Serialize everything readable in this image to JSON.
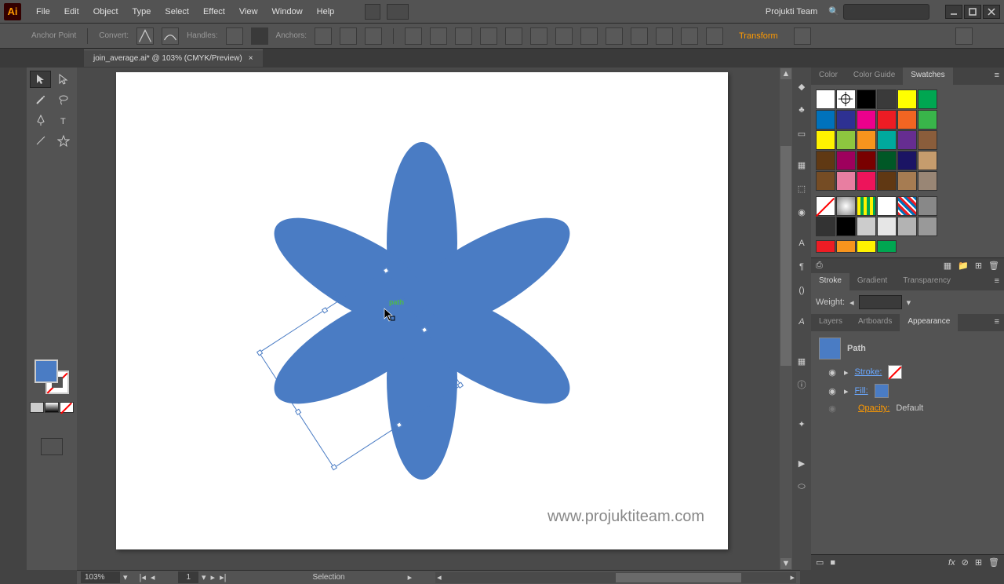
{
  "app": {
    "name": "Ai",
    "team_label": "Projukti Team"
  },
  "menu": [
    "File",
    "Edit",
    "Object",
    "Type",
    "Select",
    "Effect",
    "View",
    "Window",
    "Help"
  ],
  "control_bar": {
    "anchor_label": "Anchor Point",
    "convert_label": "Convert:",
    "handles_label": "Handles:",
    "anchors_label": "Anchors:",
    "transform_label": "Transform"
  },
  "document": {
    "tab_title": "join_average.ai* @ 103% (CMYK/Preview)"
  },
  "cursor_hint": "path",
  "watermark": "www.projuktiteam.com",
  "status": {
    "zoom": "103%",
    "artboard_nav": "1",
    "mode": "Selection"
  },
  "panels": {
    "color_tabs": [
      "Color",
      "Color Guide",
      "Swatches"
    ],
    "color_active": "Swatches",
    "swatches_rows": [
      [
        "#ffffff",
        "registration",
        "#000000",
        "#3a3a3a",
        "#ffff00",
        "#00a651"
      ],
      [
        "#0072bc",
        "#2e3192",
        "#ec008c",
        "#ed1c24",
        "#f26522",
        "#39b54a"
      ],
      [
        "#fff200",
        "#8dc63f",
        "#f7941d",
        "#00a99d",
        "#662d91",
        "#8a5d3b"
      ],
      [
        "#603913",
        "#9e005d",
        "#790000",
        "#005826",
        "#1b1464",
        "#c69c6d"
      ],
      [
        "#754c24",
        "#e87ea1",
        "#ed145b",
        "#603813",
        "#a67c52",
        "#998675"
      ]
    ],
    "pattern_row": [
      "none",
      "radial",
      "stripes-yg",
      "white",
      "stripes-rb",
      "gray"
    ],
    "gray_row": [
      "#333333",
      "#000000",
      "#cccccc",
      "#e6e6e6",
      "#b3b3b3",
      "#999999"
    ],
    "stroke_tabs": [
      "Stroke",
      "Gradient",
      "Transparency"
    ],
    "stroke_active": "Stroke",
    "weight_label": "Weight:",
    "appearance_tabs": [
      "Layers",
      "Artboards",
      "Appearance"
    ],
    "appearance_active": "Appearance",
    "appearance": {
      "object_label": "Path",
      "stroke_label": "Stroke:",
      "fill_label": "Fill:",
      "opacity_label": "Opacity:",
      "opacity_value": "Default"
    }
  }
}
